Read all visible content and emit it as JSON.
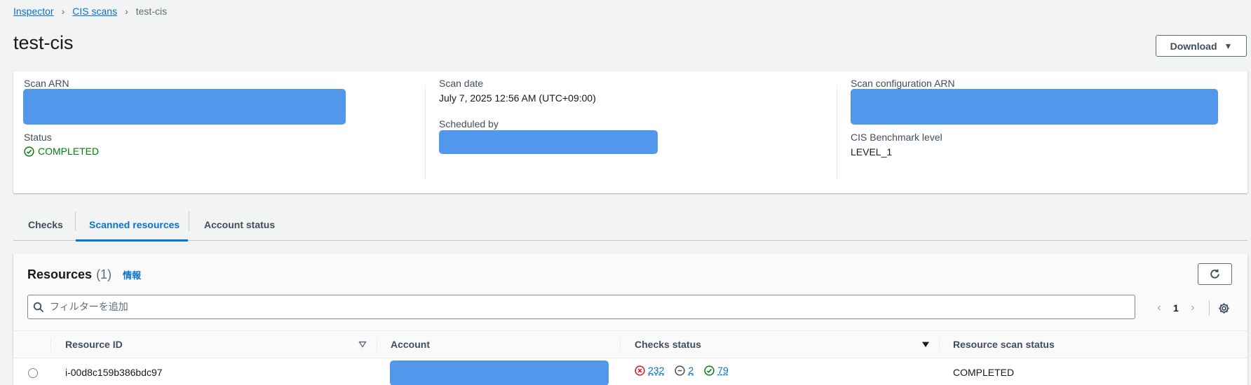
{
  "breadcrumbs": {
    "items": [
      "Inspector",
      "CIS scans"
    ],
    "current": "test-cis"
  },
  "page": {
    "title": "test-cis",
    "download_label": "Download"
  },
  "summary": {
    "scan_arn_label": "Scan ARN",
    "status_label": "Status",
    "status_value": "COMPLETED",
    "scan_date_label": "Scan date",
    "scan_date_value": "July 7, 2025 12:56 AM (UTC+09:00)",
    "scheduled_by_label": "Scheduled by",
    "scan_config_arn_label": "Scan configuration ARN",
    "cis_level_label": "CIS Benchmark level",
    "cis_level_value": "LEVEL_1"
  },
  "tabs": [
    {
      "label": "Checks",
      "active": false
    },
    {
      "label": "Scanned resources",
      "active": true
    },
    {
      "label": "Account status",
      "active": false
    }
  ],
  "resources": {
    "title": "Resources",
    "count": "(1)",
    "info_label": "情報",
    "filter_placeholder": "フィルターを追加",
    "page_number": "1",
    "columns": [
      "Resource ID",
      "Account",
      "Checks status",
      "Resource scan status"
    ],
    "rows": [
      {
        "resource_id": "i-00d8c159b386bdc97",
        "checks": {
          "failed": "232",
          "skipped": "2",
          "passed": "79"
        },
        "scan_status": "COMPLETED"
      }
    ]
  },
  "colors": {
    "link": "#0972d3",
    "success": "#037f0c",
    "error": "#d91515",
    "redaction": "#5197eb"
  }
}
